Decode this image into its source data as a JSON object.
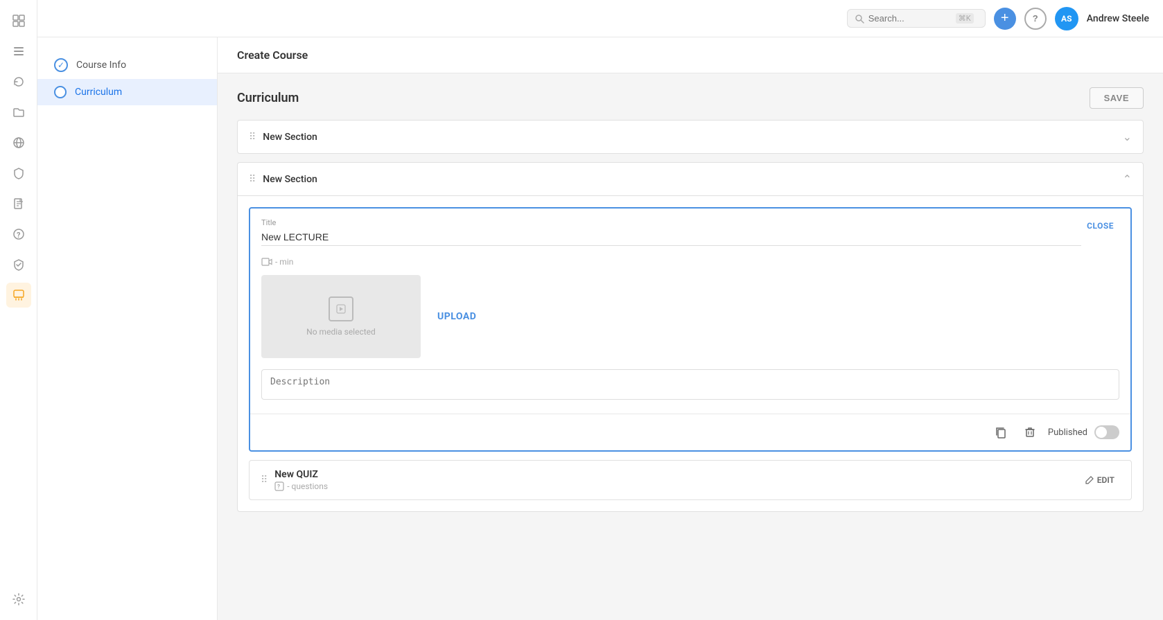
{
  "app": {
    "title": "Create Course"
  },
  "topbar": {
    "search_placeholder": "Search...",
    "search_shortcut": "⌘K",
    "user_initials": "AS",
    "user_name": "Andrew Steele",
    "user_bg": "#2196F3"
  },
  "sidebar": {
    "icons": [
      "grid",
      "list",
      "refresh",
      "folder",
      "globe",
      "shield",
      "file",
      "help",
      "shield2",
      "tag",
      "settings"
    ]
  },
  "left_nav": {
    "items": [
      {
        "id": "course-info",
        "label": "Course Info",
        "type": "check-done"
      },
      {
        "id": "curriculum",
        "label": "Curriculum",
        "type": "radio",
        "active": true
      }
    ]
  },
  "curriculum": {
    "title": "Curriculum",
    "save_label": "SAVE",
    "sections": [
      {
        "id": "section-1",
        "name": "New Section",
        "expanded": false
      },
      {
        "id": "section-2",
        "name": "New Section",
        "expanded": true,
        "items": [
          {
            "type": "lecture",
            "title_label": "Title",
            "title_value": "New LECTURE",
            "duration": "- min",
            "media_label": "No media selected",
            "upload_label": "UPLOAD",
            "description_placeholder": "Description",
            "published_label": "Published",
            "close_label": "CLOSE"
          }
        ]
      }
    ],
    "quiz": {
      "title": "New QUIZ",
      "meta": "- questions",
      "edit_label": "EDIT"
    }
  }
}
